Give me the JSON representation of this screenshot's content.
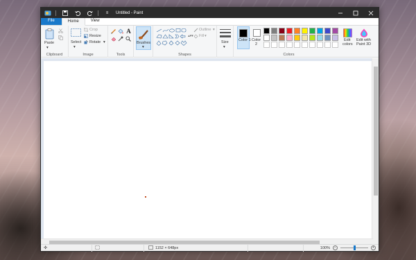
{
  "window": {
    "title": "Untitled - Paint",
    "controls": [
      "minimize",
      "maximize",
      "close"
    ]
  },
  "tabs": [
    {
      "label": "File"
    },
    {
      "label": "Home"
    },
    {
      "label": "View"
    }
  ],
  "ribbon": {
    "clipboard": {
      "label": "Clipboard",
      "paste": "Paste",
      "cut_icon": "scissors-icon",
      "copy_icon": "copy-icon"
    },
    "image": {
      "label": "Image",
      "select": "Select",
      "crop": "Crop",
      "resize": "Resize",
      "rotate": "Rotate"
    },
    "tools": {
      "label": "Tools"
    },
    "brushes": {
      "label": "Brushes"
    },
    "shapes": {
      "label": "Shapes",
      "outline": "Outline",
      "fill": "Fill"
    },
    "size": {
      "label": "Size"
    },
    "colors": {
      "label": "Colors",
      "color1": "Color 1",
      "color1_line2": "1",
      "color2": "Color",
      "color2_line2": "2",
      "edit_colors": "Edit colors",
      "edit_colors_line1": "Edit",
      "edit_colors_line2": "colors",
      "edit_3d_line1": "Edit with",
      "edit_3d_line2": "Paint 3D",
      "palette_row1": [
        "#000000",
        "#7f7f7f",
        "#880015",
        "#ed1c24",
        "#ff7f27",
        "#fff200",
        "#22b14c",
        "#00a2e8",
        "#3f48cc",
        "#a349a4"
      ],
      "palette_row2": [
        "#ffffff",
        "#c3c3c3",
        "#b97a57",
        "#ffaec9",
        "#ffc90e",
        "#efe4b0",
        "#b5e61d",
        "#99d9ea",
        "#7092be",
        "#c8bfe7"
      ],
      "color1_value": "#000000",
      "color2_value": "#ffffff"
    }
  },
  "status": {
    "dimensions": "1152 × 648px",
    "zoom": "100%"
  }
}
